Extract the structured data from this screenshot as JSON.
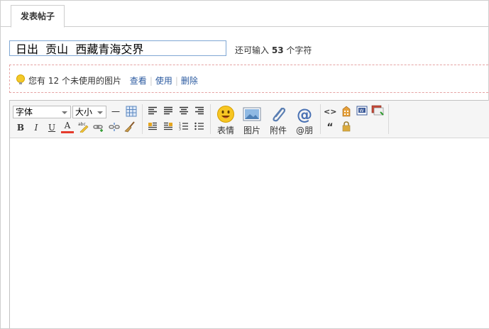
{
  "tab": {
    "label": "发表帖子"
  },
  "title": {
    "value": "日出  贡山  西藏青海交界"
  },
  "remaining": {
    "prefix": "还可输入",
    "count": "53",
    "suffix": "个字符"
  },
  "notice": {
    "text_before": "您有",
    "count": "12",
    "text_after": "个未使用的图片",
    "view_label": "查看",
    "use_label": "使用",
    "delete_label": "删除"
  },
  "toolbar": {
    "font_label": "字体",
    "size_label": "大小",
    "bold": "B",
    "italic": "I",
    "underline": "U",
    "fontcolor": "A",
    "hr": "一",
    "quote": "“",
    "code": "<>",
    "emoji_label": "表情",
    "image_label": "图片",
    "attach_label": "附件",
    "at_label": "@朋"
  },
  "colors": {
    "accent_link": "#2b5aa0",
    "input_border": "#7fa7d4",
    "notice_border": "#e6a3a3"
  }
}
